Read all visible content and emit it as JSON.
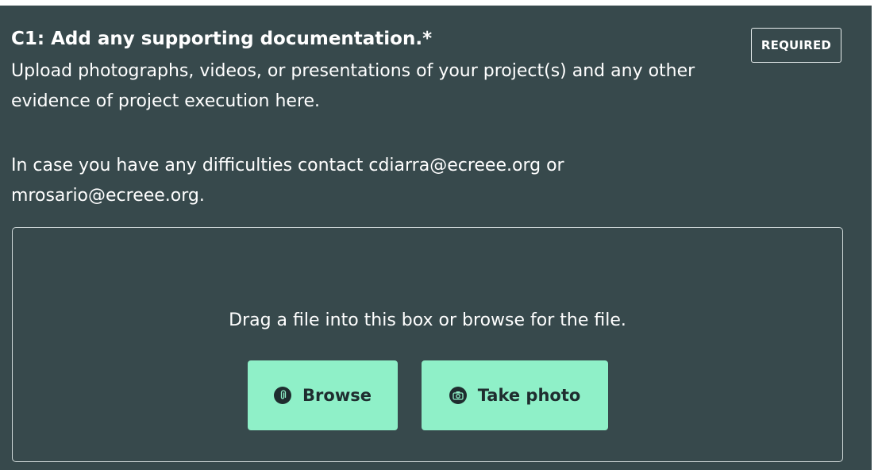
{
  "question": {
    "title": "C1: Add any supporting documentation.*",
    "badge": "REQUIRED",
    "description": "Upload photographs, videos, or presentations of your project(s) and any other evidence of project execution here.",
    "contact": "In case you have any difficulties contact cdiarra@ecreee.org or mrosario@ecreee.org."
  },
  "upload": {
    "instruction": "Drag a file into this box or browse for the file.",
    "browse_label": "Browse",
    "browse_icon": "paperclip-icon",
    "photo_label": "Take photo",
    "photo_icon": "camera-icon"
  },
  "colors": {
    "panel_bg": "#37494c",
    "button_bg": "#8ff0c8",
    "button_text": "#1f2d2f"
  }
}
